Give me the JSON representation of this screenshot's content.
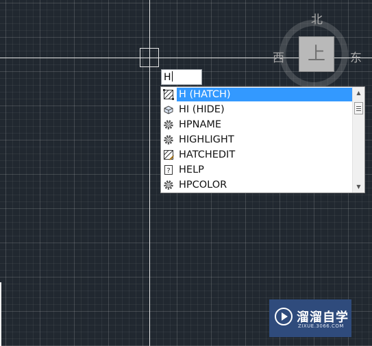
{
  "viewcube": {
    "north": "北",
    "west": "西",
    "east": "东",
    "face": "上"
  },
  "command": {
    "input_value": "H"
  },
  "autocomplete": {
    "items": [
      {
        "label": "H (HATCH)",
        "icon": "hatch-icon",
        "selected": true
      },
      {
        "label": "HI (HIDE)",
        "icon": "hide-icon",
        "selected": false
      },
      {
        "label": "HPNAME",
        "icon": "gear-icon",
        "selected": false
      },
      {
        "label": "HIGHLIGHT",
        "icon": "gear-icon",
        "selected": false
      },
      {
        "label": "HATCHEDIT",
        "icon": "hatchedit-icon",
        "selected": false
      },
      {
        "label": "HELP",
        "icon": "help-icon",
        "selected": false
      },
      {
        "label": "HPCOLOR",
        "icon": "gear-icon",
        "selected": false
      }
    ]
  },
  "watermark": {
    "title": "溜溜自学",
    "subtitle": "ZIXUE.3066.COM"
  },
  "colors": {
    "background": "#212830",
    "selection": "#3399ff",
    "watermark_bg": "#2f4b7c"
  }
}
